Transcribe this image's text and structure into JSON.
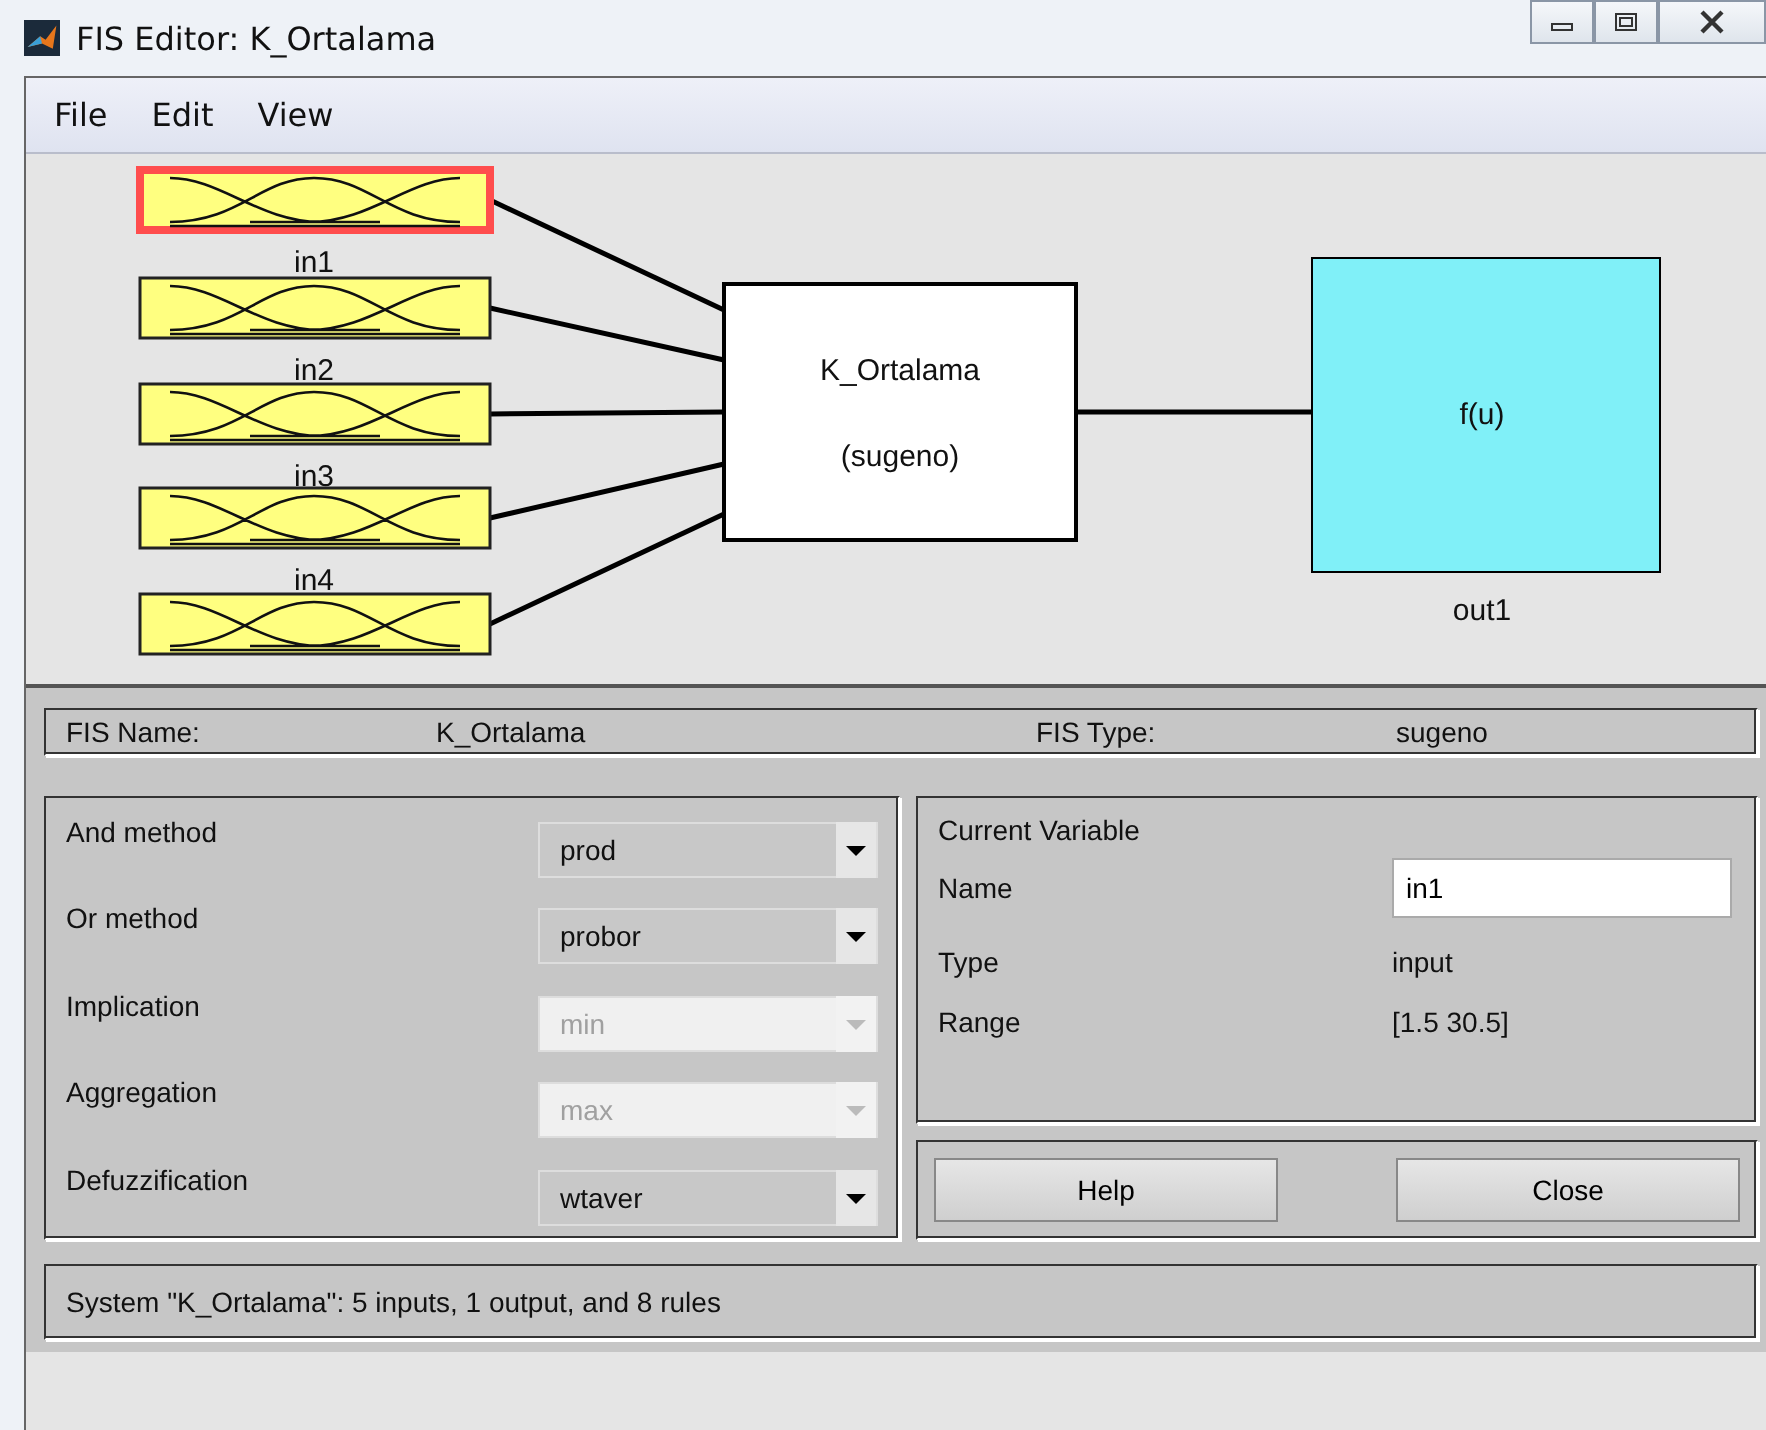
{
  "window": {
    "title": "FIS Editor: K_Ortalama"
  },
  "menu": [
    "File",
    "Edit",
    "View"
  ],
  "inputs": [
    {
      "label": "in1",
      "selected": true
    },
    {
      "label": "in2",
      "selected": false
    },
    {
      "label": "in3",
      "selected": false
    },
    {
      "label": "in4",
      "selected": false
    },
    {
      "selected": false
    }
  ],
  "system": {
    "name": "K_Ortalama",
    "type": "(sugeno)"
  },
  "output": {
    "function": "f(u)",
    "label": "out1"
  },
  "fis_info": {
    "name_label": "FIS Name:",
    "name": "K_Ortalama",
    "type_label": "FIS Type:",
    "type": "sugeno"
  },
  "methods": [
    {
      "label": "And method",
      "value": "prod",
      "disabled": false
    },
    {
      "label": "Or method",
      "value": "probor",
      "disabled": false
    },
    {
      "label": "Implication",
      "value": "min",
      "disabled": true
    },
    {
      "label": "Aggregation",
      "value": "max",
      "disabled": true
    },
    {
      "label": "Defuzzification",
      "value": "wtaver",
      "disabled": false
    }
  ],
  "current_variable": {
    "title": "Current Variable",
    "name_label": "Name",
    "name": "in1",
    "type_label": "Type",
    "type": "input",
    "range_label": "Range",
    "range": "[1.5 30.5]"
  },
  "buttons": [
    "Help",
    "Close"
  ],
  "status": "System \"K_Ortalama\": 5 inputs, 1 output, and 8 rules"
}
